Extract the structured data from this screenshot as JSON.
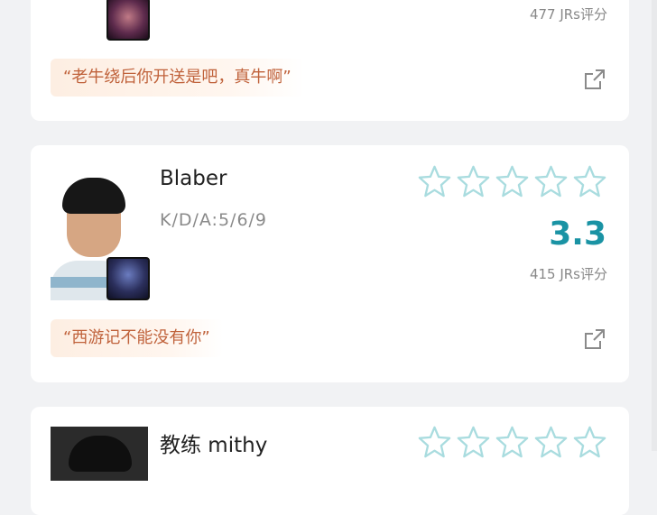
{
  "cards": [
    {
      "player_name": "",
      "kda": "",
      "score": "",
      "votes": "477 JRs评分",
      "comment": "“老牛绕后你开送是吧，真牛啊”"
    },
    {
      "player_name": "Blaber",
      "kda": "K/D/A:5/6/9",
      "score": "3.3",
      "votes": "415 JRs评分",
      "comment": "“西游记不能没有你”"
    },
    {
      "player_name": "教练 mithy",
      "kda": "",
      "score": "",
      "votes": "",
      "comment": ""
    }
  ],
  "icons": {
    "star": "star-outline-icon",
    "share": "external-share-icon",
    "champion": "champion-portrait"
  },
  "colors": {
    "accent": "#1a93a4",
    "star_outline": "#a9dcdf",
    "quote_text": "#c0623b"
  }
}
